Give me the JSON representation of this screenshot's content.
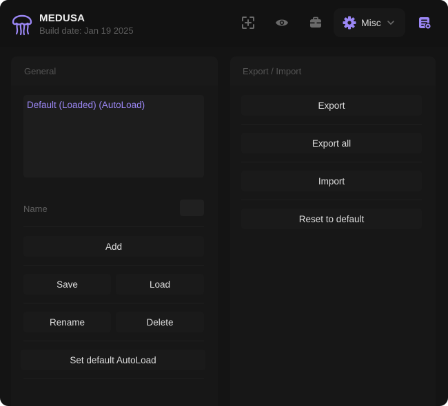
{
  "app": {
    "title": "MEDUSA",
    "build_date": "Build date: Jan 19 2025"
  },
  "header": {
    "icons": [
      "crosshair-add-icon",
      "eye-icon",
      "briefcase-icon",
      "settings-list-icon"
    ],
    "misc": {
      "label": "Misc",
      "icon": "gear-icon"
    }
  },
  "general": {
    "title": "General",
    "configs": [
      "Default (Loaded) (AutoLoad)"
    ],
    "name_label": "Name",
    "name_value": "",
    "buttons": {
      "add": "Add",
      "save": "Save",
      "load": "Load",
      "rename": "Rename",
      "delete": "Delete",
      "set_default": "Set default AutoLoad"
    }
  },
  "export_import": {
    "title": "Export / Import",
    "buttons": {
      "export": "Export",
      "export_all": "Export all",
      "import": "Import",
      "reset": "Reset to default"
    }
  },
  "colors": {
    "accent": "#9b87f5",
    "background": "#141414"
  }
}
